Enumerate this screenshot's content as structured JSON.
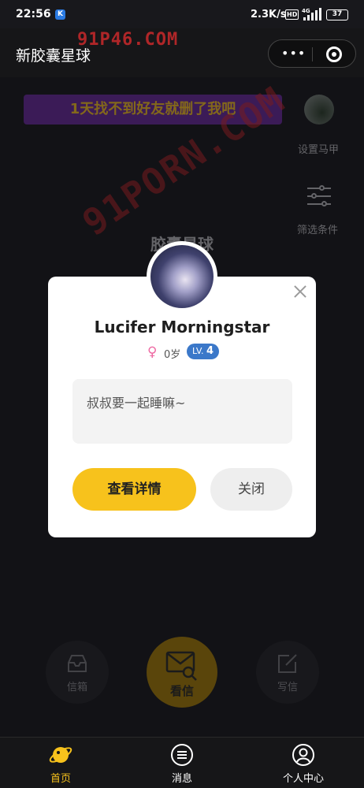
{
  "status_bar": {
    "time": "22:56",
    "app_badge": "K",
    "network_speed": "2.3K/s",
    "hd_label": "HD",
    "signal_label": "4G",
    "battery_level": "37"
  },
  "header": {
    "title": "新胶囊星球",
    "watermark": "91P46.COM"
  },
  "main": {
    "promo_banner": "1天找不到好友就删了我吧",
    "side_actions": [
      {
        "label": "设置马甲",
        "icon": "avatar-icon"
      },
      {
        "label": "筛选条件",
        "icon": "filter-icon"
      }
    ],
    "planet_title": "胶囊星球",
    "diagonal_watermark": "91PORN.COM",
    "actions": {
      "inbox_label": "信箱",
      "view_letter_label": "看信",
      "write_label": "写信"
    }
  },
  "modal": {
    "user_name": "Lucifer Morningstar",
    "gender_icon": "female-icon",
    "age": "0岁",
    "level_prefix": "LV.",
    "level_value": "4",
    "message": "叔叔要一起睡嘛~",
    "detail_button": "查看详情",
    "close_button": "关闭"
  },
  "tabbar": {
    "tabs": [
      {
        "label": "首页",
        "icon": "planet-icon",
        "active": true
      },
      {
        "label": "消息",
        "icon": "message-icon",
        "active": false
      },
      {
        "label": "个人中心",
        "icon": "user-icon",
        "active": false
      }
    ]
  },
  "colors": {
    "accent": "#f7c21c",
    "level_badge": "#3b78c9",
    "gender_female": "#ee6aa3",
    "promo_bg": "#5b2a86",
    "watermark": "#c0282a"
  }
}
